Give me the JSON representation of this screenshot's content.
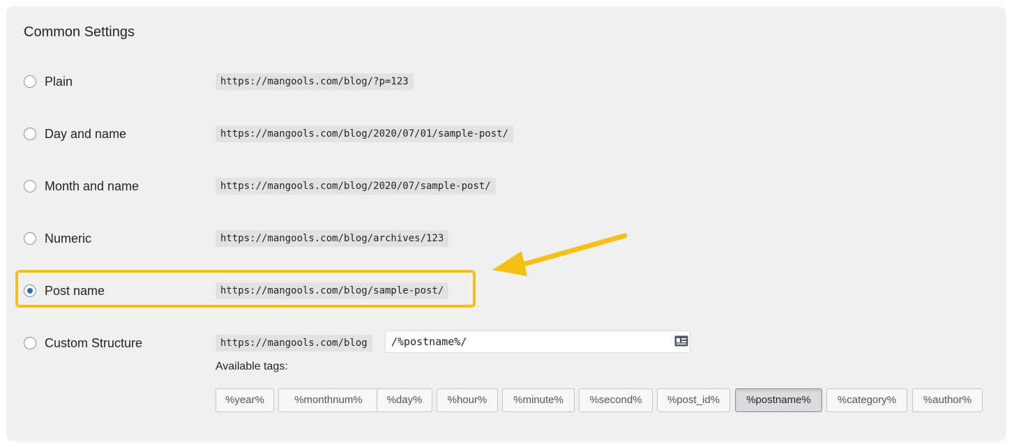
{
  "section": {
    "title": "Common Settings"
  },
  "options": [
    {
      "label": "Plain",
      "url": "https://mangools.com/blog/?p=123",
      "checked": false
    },
    {
      "label": "Day and name",
      "url": "https://mangools.com/blog/2020/07/01/sample-post/",
      "checked": false
    },
    {
      "label": "Month and name",
      "url": "https://mangools.com/blog/2020/07/sample-post/",
      "checked": false
    },
    {
      "label": "Numeric",
      "url": "https://mangools.com/blog/archives/123",
      "checked": false
    },
    {
      "label": "Post name",
      "url": "https://mangools.com/blog/sample-post/",
      "checked": true
    }
  ],
  "custom": {
    "label": "Custom Structure",
    "base_url": "https://mangools.com/blog",
    "value": "/%postname%/",
    "checked": false,
    "available_tags_label": "Available tags:",
    "tags": [
      {
        "label": "%year%",
        "active": false
      },
      {
        "label": "%monthnum%",
        "active": false
      },
      {
        "label": "%day%",
        "active": false
      },
      {
        "label": "%hour%",
        "active": false
      },
      {
        "label": "%minute%",
        "active": false
      },
      {
        "label": "%second%",
        "active": false
      },
      {
        "label": "%post_id%",
        "active": false
      },
      {
        "label": "%postname%",
        "active": true
      },
      {
        "label": "%category%",
        "active": false
      },
      {
        "label": "%author%",
        "active": false
      }
    ]
  },
  "colors": {
    "highlight": "#f5c013",
    "radio_checked": "#2271b1",
    "panel_bg": "#f0f0f1"
  },
  "icons": {
    "input_icon": "id-card-icon",
    "annotation_arrow": "arrow-icon"
  }
}
